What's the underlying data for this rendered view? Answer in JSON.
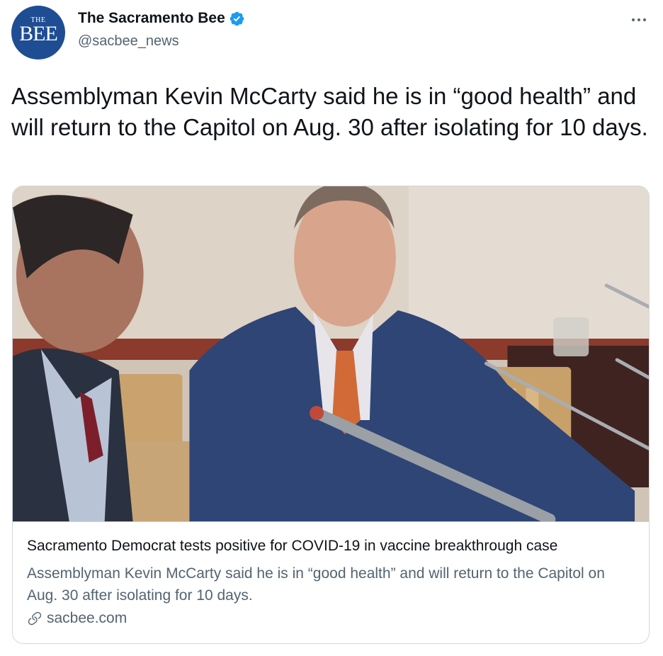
{
  "account": {
    "avatar_small": "THE",
    "avatar_big": "BEE",
    "name": "The Sacramento Bee",
    "handle": "@sacbee_news",
    "verified": true
  },
  "tweet": {
    "text": "Assemblyman Kevin McCarty said he is in “good health” and will return to the Capitol on Aug. 30 after isolating for 10 days."
  },
  "card": {
    "title": "Sacramento Democrat tests positive for COVID-19 in vaccine breakthrough case",
    "description": "Assemblyman Kevin McCarty said he is in “good health” and will return to the Capitol on Aug. 30 after isolating for 10 days.",
    "domain": "sacbee.com"
  },
  "icons": {
    "more": "more-options-icon",
    "verified": "verified-badge-icon",
    "link": "link-icon"
  },
  "colors": {
    "avatar_bg": "#1f4d93",
    "verified": "#1d9bf0",
    "secondary_text": "#536471",
    "border": "#cfd9de"
  }
}
